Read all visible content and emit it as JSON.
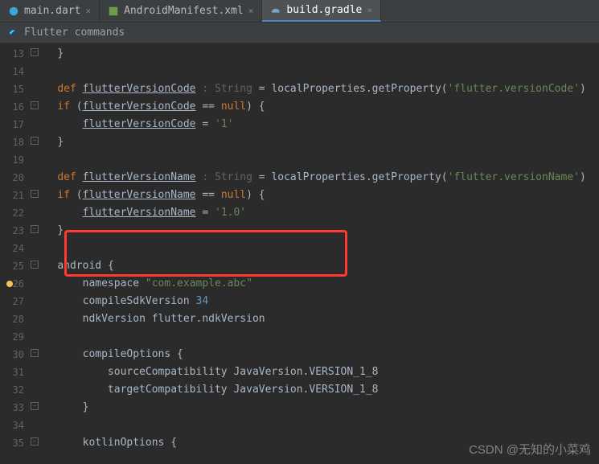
{
  "tabs": [
    {
      "label": "main.dart",
      "icon": "dart"
    },
    {
      "label": "AndroidManifest.xml",
      "icon": "xml"
    },
    {
      "label": "build.gradle",
      "icon": "gradle"
    }
  ],
  "banner": {
    "label": "Flutter commands"
  },
  "gutter": {
    "start": 13,
    "end": 35
  },
  "code": {
    "l13": "}",
    "l15": {
      "def": "def",
      "name": "flutterVersionCode",
      "hint": ": String",
      "eq": "=",
      "call": "localProperties.getProperty(",
      "arg": "'flutter.versionCode'",
      "close": ")"
    },
    "l16": {
      "if": "if",
      "open": "(",
      "name": "flutterVersionCode",
      "eq": "==",
      "null": "null",
      "close": ") {"
    },
    "l17": {
      "name": "flutterVersionCode",
      "eq": "=",
      "val": "'1'"
    },
    "l18": "}",
    "l20": {
      "def": "def",
      "name": "flutterVersionName",
      "hint": ": String",
      "eq": "=",
      "call": "localProperties.getProperty(",
      "arg": "'flutter.versionName'",
      "close": ")"
    },
    "l21": {
      "if": "if",
      "open": "(",
      "name": "flutterVersionName",
      "eq": "==",
      "null": "null",
      "close": ") {"
    },
    "l22": {
      "name": "flutterVersionName",
      "eq": "=",
      "val": "'1.0'"
    },
    "l23": "}",
    "l25": {
      "name": "android",
      "brace": "{"
    },
    "l26": {
      "key": "namespace",
      "val": "\"com.example.abc\""
    },
    "l27": {
      "key": "compileSdkVersion",
      "val": "34"
    },
    "l28": {
      "key": "ndkVersion",
      "val": "flutter.ndkVersion"
    },
    "l30": {
      "key": "compileOptions",
      "brace": "{"
    },
    "l31": {
      "key": "sourceCompatibility",
      "val": "JavaVersion.VERSION_1_8"
    },
    "l32": {
      "key": "targetCompatibility",
      "val": "JavaVersion.VERSION_1_8"
    },
    "l33": "}",
    "l35": {
      "key": "kotlinOptions",
      "brace": "{"
    }
  },
  "watermark": "CSDN @无知的小菜鸡"
}
